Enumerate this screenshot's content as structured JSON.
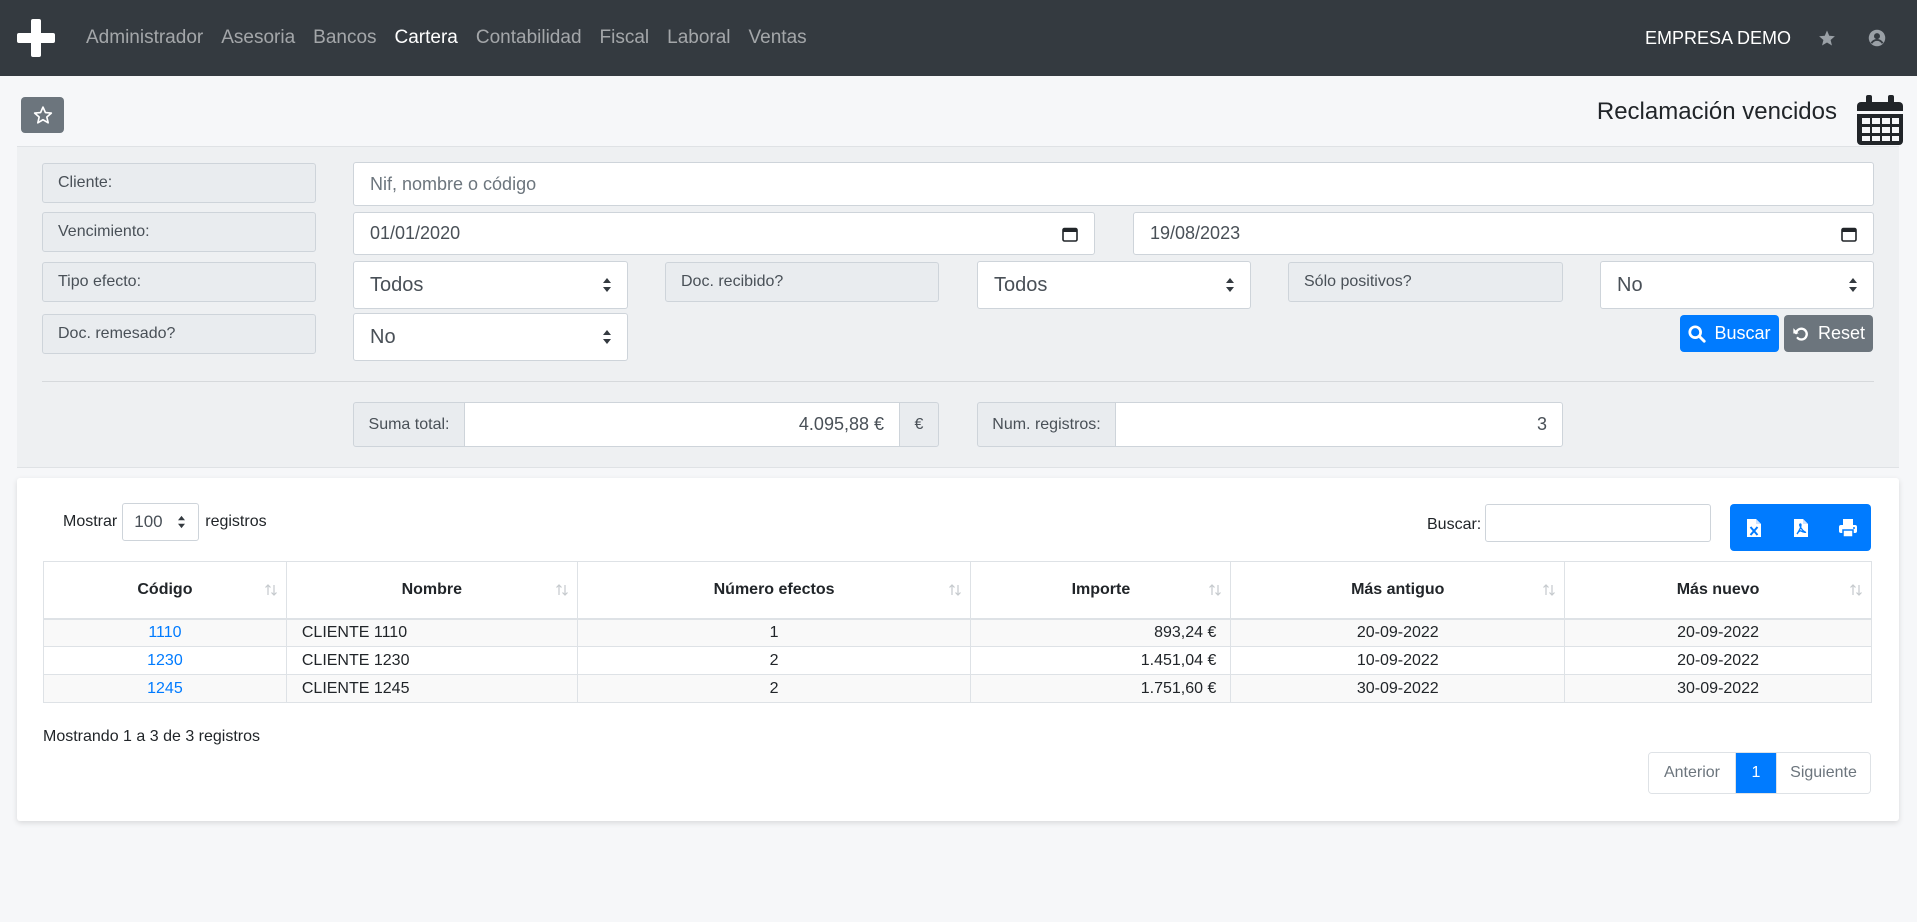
{
  "navbar": {
    "menu": [
      "Administrador",
      "Asesoria",
      "Bancos",
      "Cartera",
      "Contabilidad",
      "Fiscal",
      "Laboral",
      "Ventas"
    ],
    "active": "Cartera",
    "company": "EMPRESA DEMO",
    "icons": [
      "plus-logo-icon",
      "star-icon",
      "user-icon"
    ]
  },
  "page": {
    "title": "Reclamación vencidos",
    "title_icon": "calendar-icon"
  },
  "filters": {
    "cliente_label": "Cliente:",
    "cliente_placeholder": "Nif, nombre o código",
    "vencimiento_label": "Vencimiento:",
    "vencimiento_desde": "01/01/2020",
    "vencimiento_hasta": "19/08/2023",
    "tipo_efecto_label": "Tipo efecto:",
    "tipo_efecto_value": "Todos",
    "doc_recibido_label": "Doc. recibido?",
    "doc_recibido_value": "Todos",
    "solo_positivos_label": "Sólo positivos?",
    "solo_positivos_value": "No",
    "doc_remesado_label": "Doc. remesado?",
    "doc_remesado_value": "No",
    "buscar_label": "Buscar",
    "reset_label": "Reset"
  },
  "totals": {
    "suma_label": "Suma total:",
    "suma_value": "4.095,88 €",
    "currency": "€",
    "num_label": "Num. registros:",
    "num_value": "3"
  },
  "table_controls": {
    "show_prefix": "Mostrar",
    "page_size": "100",
    "show_suffix": "registros",
    "search_label": "Buscar:",
    "search_value": "",
    "export_icons": [
      "excel-icon",
      "pdf-icon",
      "print-icon"
    ]
  },
  "table": {
    "columns": [
      "Código",
      "Nombre",
      "Número efectos",
      "Importe",
      "Más antiguo",
      "Más nuevo"
    ],
    "rows": [
      [
        "1110",
        "CLIENTE 1110",
        "1",
        "893,24 €",
        "20-09-2022",
        "20-09-2022"
      ],
      [
        "1230",
        "CLIENTE 1230",
        "2",
        "1.451,04 €",
        "10-09-2022",
        "20-09-2022"
      ],
      [
        "1245",
        "CLIENTE 1245",
        "2",
        "1.751,60 €",
        "30-09-2022",
        "30-09-2022"
      ]
    ]
  },
  "footer": {
    "info": "Mostrando 1 a 3 de 3 registros",
    "prev": "Anterior",
    "current_page": "1",
    "next": "Siguiente"
  },
  "colors": {
    "navbar": "#343a40",
    "primary": "#007bff",
    "secondary": "#6c757d"
  }
}
